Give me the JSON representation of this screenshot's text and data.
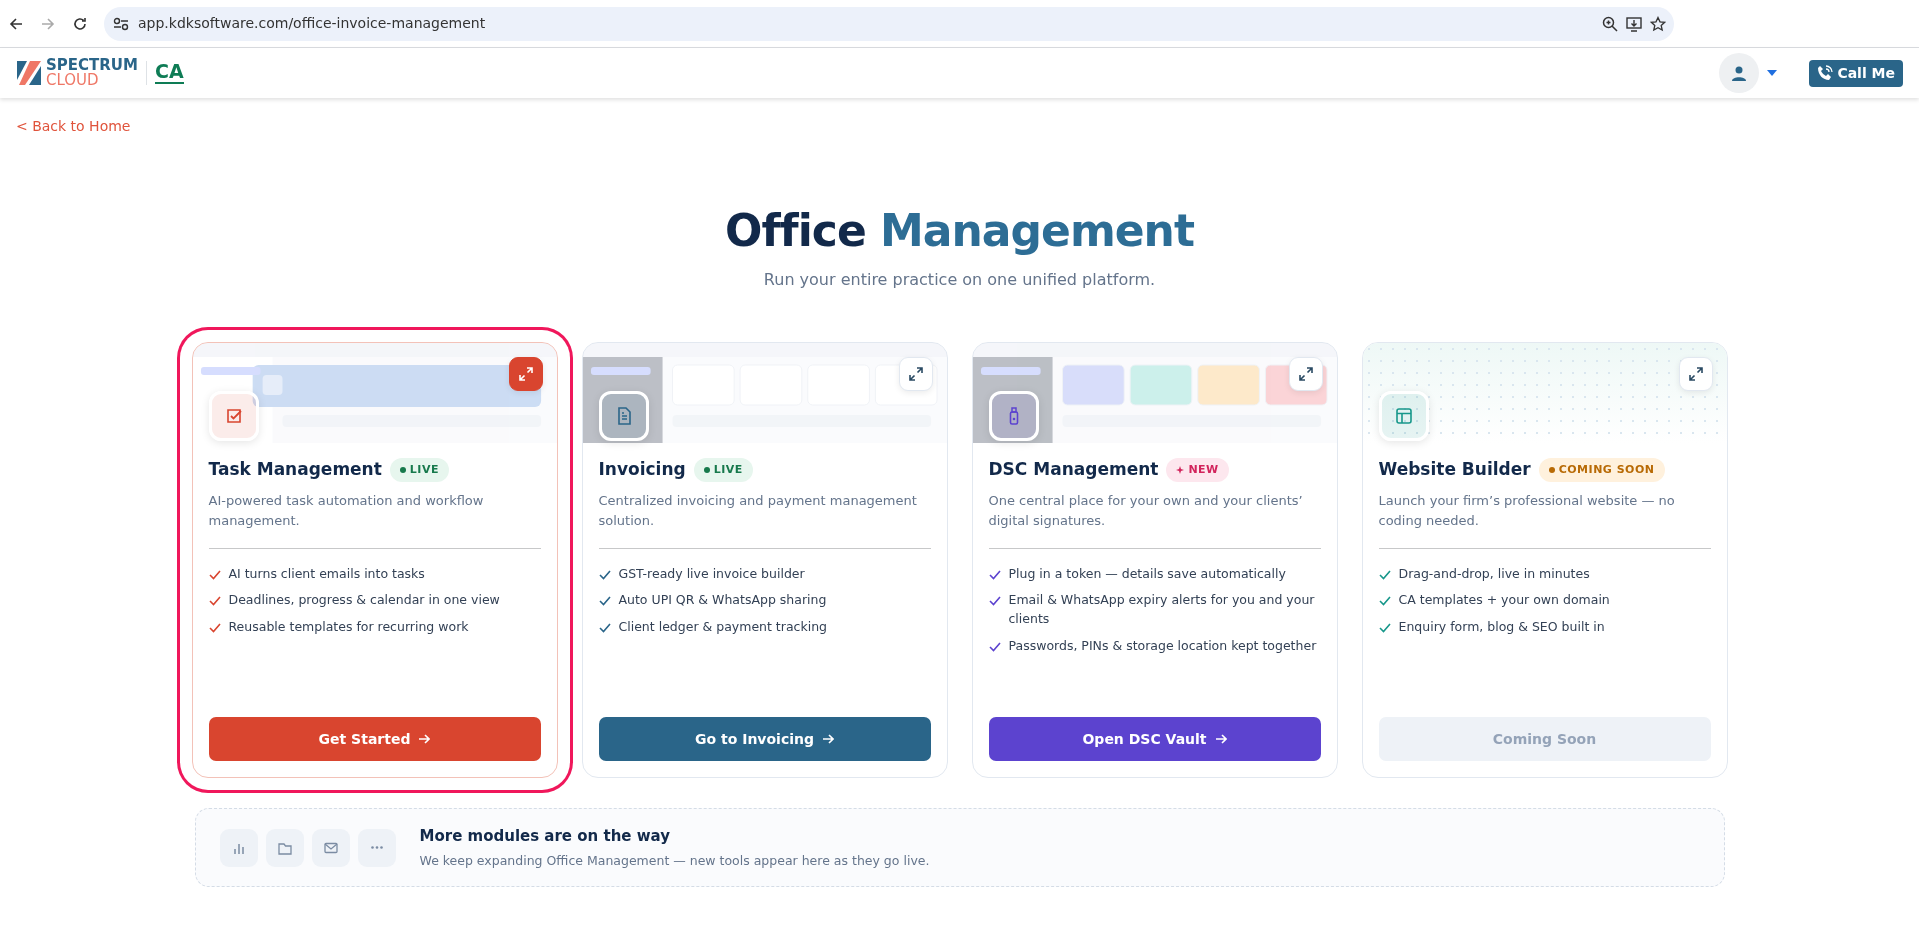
{
  "browser": {
    "url": "app.kdksoftware.com/office-invoice-management"
  },
  "header": {
    "logo_line1": "SPECTRUM",
    "logo_line2": "CLOUD",
    "logo_suffix": "CA",
    "call_button": "Call Me"
  },
  "back_link": "< Back to Home",
  "hero": {
    "title_start": "Office",
    "title_end": "Management",
    "subtitle": "Run your entire practice on one unified platform."
  },
  "cards": [
    {
      "title": "Task Management",
      "badge": {
        "kind": "live",
        "text": "LIVE"
      },
      "description": "AI-powered task automation and workflow management.",
      "features": [
        "AI turns client emails into tasks",
        "Deadlines, progress & calendar in one view",
        "Reusable templates for recurring work"
      ],
      "button": {
        "label": "Get Started",
        "disabled": false
      },
      "color": "#d9452f",
      "highlighted": true,
      "preview": {
        "kind": "picture"
      }
    },
    {
      "title": "Invoicing",
      "badge": {
        "kind": "live",
        "text": "LIVE"
      },
      "description": "Centralized invoicing and payment management solution.",
      "features": [
        "GST-ready live invoice builder",
        "Auto UPI QR & WhatsApp sharing",
        "Client ledger & payment tracking"
      ],
      "button": {
        "label": "Go to Invoicing",
        "disabled": false
      },
      "color": "#2a6589",
      "highlighted": false,
      "preview": {
        "kind": "picture"
      }
    },
    {
      "title": "DSC Management",
      "badge": {
        "kind": "new",
        "text": "NEW"
      },
      "description": "One central place for your own and your clients’ digital signatures.",
      "features": [
        "Plug in a token — details save automatically",
        "Email & WhatsApp expiry alerts for you and your clients",
        "Passwords, PINs & storage location kept together"
      ],
      "button": {
        "label": "Open DSC Vault",
        "disabled": false
      },
      "color": "#5c43cf",
      "highlighted": false,
      "preview": {
        "kind": "picture"
      }
    },
    {
      "title": "Website Builder",
      "badge": {
        "kind": "soon",
        "text": "COMING SOON"
      },
      "description": "Launch your firm’s professional website — no coding needed.",
      "features": [
        "Drag-and-drop, live in minutes",
        "CA templates + your own domain",
        "Enquiry form, blog & SEO built in"
      ],
      "button": {
        "label": "Coming Soon",
        "disabled": true
      },
      "color": "#17978a",
      "highlighted": false
    }
  ],
  "more": {
    "title": "More modules are on the way",
    "text": "We keep expanding Office Management — new tools appear here as they go live."
  }
}
